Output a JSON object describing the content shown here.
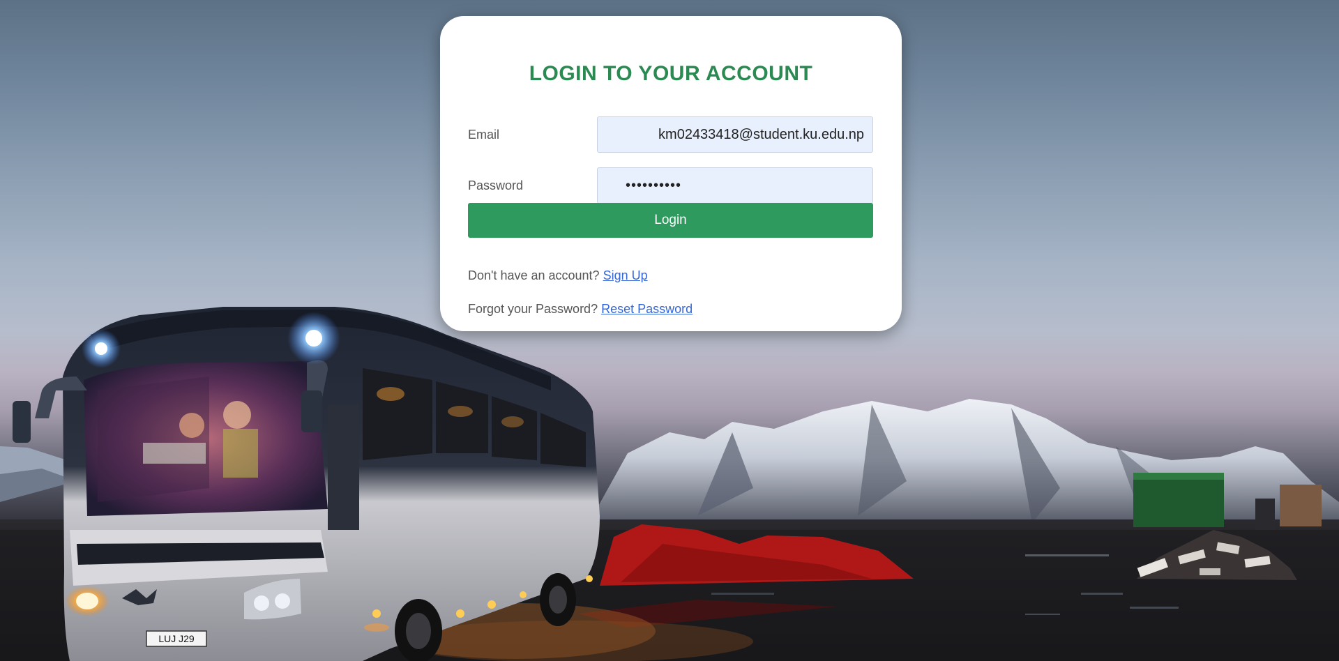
{
  "login_card": {
    "title": "LOGIN TO YOUR ACCOUNT",
    "email_label": "Email",
    "email_value": "km02433418@student.ku.edu.np",
    "password_label": "Password",
    "password_value": "••••••••••",
    "login_button": "Login",
    "signup_prompt": "Don't have an account?",
    "signup_link": "Sign Up",
    "reset_prompt": "Forgot your Password?",
    "reset_link": "Reset Password"
  },
  "background": {
    "bus_license_plate": "LUJ J29"
  },
  "colors": {
    "title_green": "#2a8a52",
    "button_green": "#2e9a5e",
    "link_blue": "#3567d8",
    "input_fill": "#e8effd"
  }
}
